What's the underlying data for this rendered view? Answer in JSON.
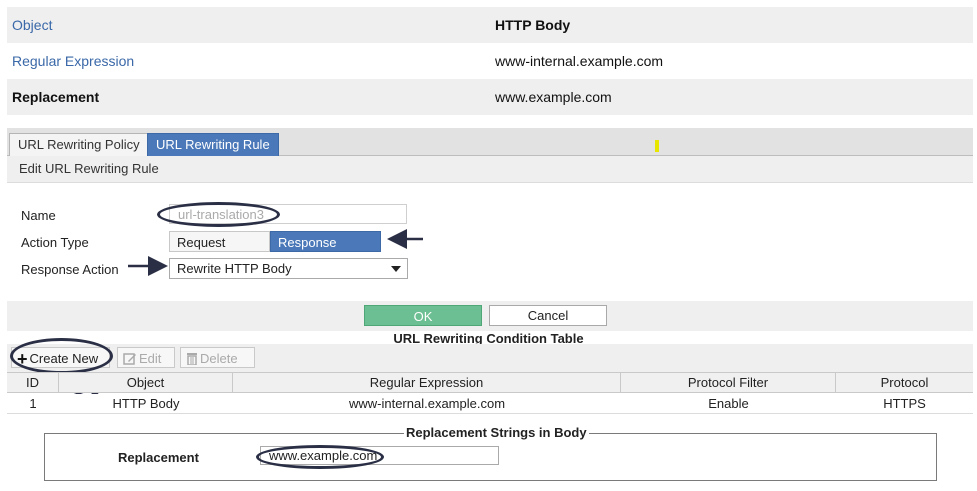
{
  "summary": {
    "rows": [
      {
        "label": "Object",
        "value": "HTTP Body"
      },
      {
        "label": "Regular Expression",
        "value": "www-internal.example.com"
      },
      {
        "label": "Replacement",
        "value": "www.example.com"
      }
    ]
  },
  "tabs": [
    {
      "label": "URL Rewriting Policy"
    },
    {
      "label": "URL Rewriting Rule",
      "active": true
    }
  ],
  "form": {
    "header": "Edit URL Rewriting Rule",
    "name_label": "Name",
    "name_value": "url-translation3",
    "action_type_label": "Action Type",
    "action_types": [
      "Request Action",
      "Response Action"
    ],
    "action_type_selected": "Response Action",
    "response_action_label": "Response Action",
    "response_action_value": "Rewrite HTTP Body"
  },
  "buttons": {
    "ok": "OK",
    "cancel": "Cancel"
  },
  "condition_table": {
    "title": "URL Rewriting Condition Table",
    "toolbar": {
      "create": "Create New",
      "edit": "Edit",
      "delete": "Delete"
    },
    "columns": [
      "ID",
      "Object",
      "Regular Expression",
      "Protocol Filter",
      "Protocol"
    ],
    "rows": [
      [
        "1",
        "HTTP Body",
        "www-internal.example.com",
        "Enable",
        "HTTPS"
      ]
    ]
  },
  "replacement_box": {
    "legend": "Replacement Strings in Body",
    "label": "Replacement",
    "value": "www.example.com"
  },
  "colors": {
    "accent": "#4a78b8",
    "ok": "#6cbf92",
    "link": "#3a68a8",
    "annotation": "#2a2f45"
  }
}
